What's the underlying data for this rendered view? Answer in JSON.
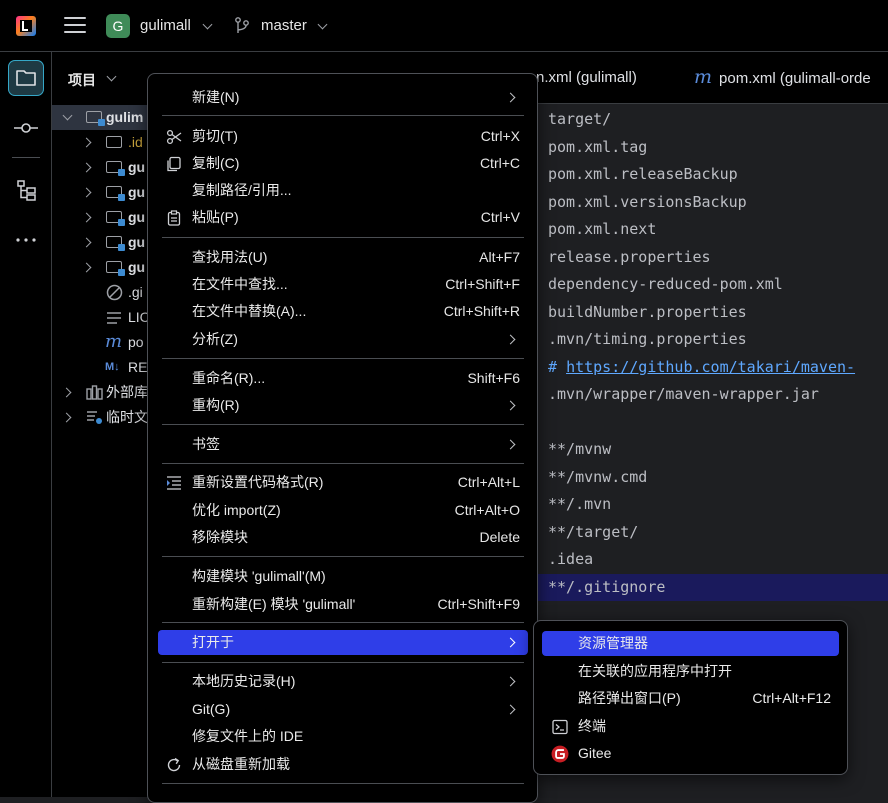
{
  "titlebar": {
    "project_badge": "G",
    "project_name": "gulimall",
    "branch": "master"
  },
  "project_panel": {
    "title": "项目",
    "tree": [
      {
        "label": "gulim",
        "type": "module-folder",
        "bold": true
      },
      {
        "label": ".id",
        "type": "folder",
        "color": "yellow"
      },
      {
        "label": "gu",
        "type": "module-folder",
        "bold": true
      },
      {
        "label": "gu",
        "type": "module-folder",
        "bold": true
      },
      {
        "label": "gu",
        "type": "module-folder",
        "bold": true
      },
      {
        "label": "gu",
        "type": "module-folder",
        "bold": true
      },
      {
        "label": "gu",
        "type": "module-folder",
        "bold": true
      },
      {
        "label": ".gi",
        "type": "gitignore-file"
      },
      {
        "label": "LIC",
        "type": "text-file"
      },
      {
        "label": "po",
        "type": "maven-file"
      },
      {
        "label": "RE",
        "type": "markdown-file"
      },
      {
        "label": "外部库",
        "type": "library"
      },
      {
        "label": "临时文",
        "type": "scratch"
      }
    ]
  },
  "editor": {
    "tabs": [
      {
        "label": "n.xml (gulimall)"
      },
      {
        "label": "pom.xml (gulimall-orde"
      }
    ],
    "lines": [
      "target/",
      "pom.xml.tag",
      "pom.xml.releaseBackup",
      "pom.xml.versionsBackup",
      "pom.xml.next",
      "release.properties",
      "dependency-reduced-pom.xml",
      "buildNumber.properties",
      ".mvn/timing.properties",
      "https://github.com/takari/maven-",
      ".mvn/wrapper/maven-wrapper.jar",
      "",
      "**/mvnw",
      "**/mvnw.cmd",
      "**/.mvn",
      "**/target/",
      ".idea",
      "**/.gitignore"
    ],
    "comment_prefix": "# "
  },
  "context_menu": {
    "items": [
      {
        "label": "新建(N)",
        "shortcut": "",
        "submenu": true
      },
      {
        "label": "剪切(T)",
        "shortcut": "Ctrl+X",
        "icon": "scissors-icon"
      },
      {
        "label": "复制(C)",
        "shortcut": "Ctrl+C",
        "icon": "copy-icon"
      },
      {
        "label": "复制路径/引用...",
        "shortcut": ""
      },
      {
        "label": "粘贴(P)",
        "shortcut": "Ctrl+V",
        "icon": "paste-icon"
      },
      {
        "label": "查找用法(U)",
        "shortcut": "Alt+F7"
      },
      {
        "label": "在文件中查找...",
        "shortcut": "Ctrl+Shift+F"
      },
      {
        "label": "在文件中替换(A)...",
        "shortcut": "Ctrl+Shift+R"
      },
      {
        "label": "分析(Z)",
        "shortcut": "",
        "submenu": true
      },
      {
        "label": "重命名(R)...",
        "shortcut": "Shift+F6"
      },
      {
        "label": "重构(R)",
        "shortcut": "",
        "submenu": true
      },
      {
        "label": "书签",
        "shortcut": "",
        "submenu": true
      },
      {
        "label": "重新设置代码格式(R)",
        "shortcut": "Ctrl+Alt+L",
        "icon": "reformat-icon"
      },
      {
        "label": "优化 import(Z)",
        "shortcut": "Ctrl+Alt+O"
      },
      {
        "label": "移除模块",
        "shortcut": "Delete"
      },
      {
        "label": "构建模块 'gulimall'(M)",
        "shortcut": ""
      },
      {
        "label": "重新构建(E) 模块 'gulimall'",
        "shortcut": "Ctrl+Shift+F9"
      },
      {
        "label": "打开于",
        "shortcut": "",
        "submenu": true,
        "highlighted": true
      },
      {
        "label": "本地历史记录(H)",
        "shortcut": "",
        "submenu": true
      },
      {
        "label": "Git(G)",
        "shortcut": "",
        "submenu": true
      },
      {
        "label": "修复文件上的 IDE",
        "shortcut": ""
      },
      {
        "label": "从磁盘重新加载",
        "shortcut": "",
        "icon": "reload-icon"
      }
    ]
  },
  "submenu": {
    "items": [
      {
        "label": "资源管理器",
        "shortcut": "",
        "highlighted": true
      },
      {
        "label": "在关联的应用程序中打开",
        "shortcut": ""
      },
      {
        "label": "路径弹出窗口(P)",
        "shortcut": "Ctrl+Alt+F12"
      },
      {
        "label": "终端",
        "shortcut": "",
        "icon": "terminal-icon"
      },
      {
        "label": "Gitee",
        "shortcut": "",
        "icon": "gitee-icon"
      }
    ]
  },
  "colors": {
    "highlight": "#2f3ee8",
    "accent": "#35a7c7",
    "gitee": "#c71d23"
  }
}
